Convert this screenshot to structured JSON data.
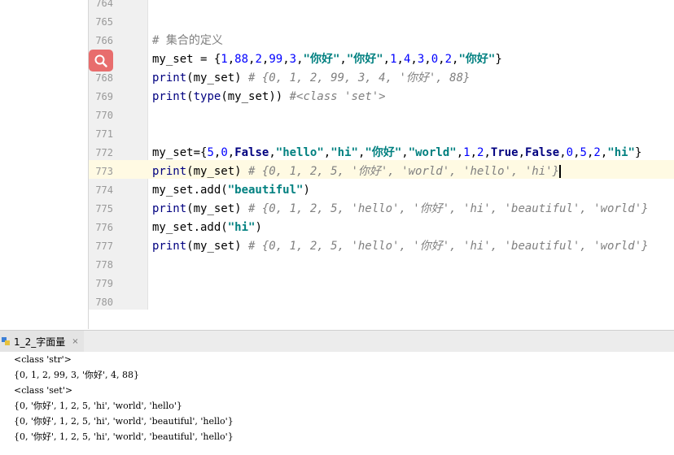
{
  "editor": {
    "lines": [
      {
        "no": "764"
      },
      {
        "no": "765"
      },
      {
        "no": "766",
        "parts": [
          {
            "t": "# 集合的定义",
            "c": "cm-plain"
          }
        ]
      },
      {
        "no": "",
        "parts": [
          {
            "t": "my_set = {",
            "c": ""
          },
          {
            "t": "1",
            "c": "num"
          },
          {
            "t": ",",
            "c": ""
          },
          {
            "t": "88",
            "c": "num"
          },
          {
            "t": ",",
            "c": ""
          },
          {
            "t": "2",
            "c": "num"
          },
          {
            "t": ",",
            "c": ""
          },
          {
            "t": "99",
            "c": "num"
          },
          {
            "t": ",",
            "c": ""
          },
          {
            "t": "3",
            "c": "num"
          },
          {
            "t": ",",
            "c": ""
          },
          {
            "t": "\"你好\"",
            "c": "str"
          },
          {
            "t": ",",
            "c": ""
          },
          {
            "t": "\"你好\"",
            "c": "str"
          },
          {
            "t": ",",
            "c": ""
          },
          {
            "t": "1",
            "c": "num"
          },
          {
            "t": ",",
            "c": ""
          },
          {
            "t": "4",
            "c": "num"
          },
          {
            "t": ",",
            "c": ""
          },
          {
            "t": "3",
            "c": "num"
          },
          {
            "t": ",",
            "c": ""
          },
          {
            "t": "0",
            "c": "num"
          },
          {
            "t": ",",
            "c": ""
          },
          {
            "t": "2",
            "c": "num"
          },
          {
            "t": ",",
            "c": ""
          },
          {
            "t": "\"你好\"",
            "c": "str"
          },
          {
            "t": "}",
            "c": ""
          }
        ]
      },
      {
        "no": "768",
        "parts": [
          {
            "t": "print",
            "c": "bi"
          },
          {
            "t": "(my_set) ",
            "c": ""
          },
          {
            "t": "# {0, 1, 2, 99, 3, 4, '你好', 88}",
            "c": "cm"
          }
        ]
      },
      {
        "no": "769",
        "parts": [
          {
            "t": "print",
            "c": "bi"
          },
          {
            "t": "(",
            "c": ""
          },
          {
            "t": "type",
            "c": "bi"
          },
          {
            "t": "(my_set)) ",
            "c": ""
          },
          {
            "t": "#<class 'set'>",
            "c": "cm"
          }
        ]
      },
      {
        "no": "770"
      },
      {
        "no": "771"
      },
      {
        "no": "772",
        "parts": [
          {
            "t": "my_set={",
            "c": ""
          },
          {
            "t": "5",
            "c": "num"
          },
          {
            "t": ",",
            "c": ""
          },
          {
            "t": "0",
            "c": "num"
          },
          {
            "t": ",",
            "c": ""
          },
          {
            "t": "False",
            "c": "kw"
          },
          {
            "t": ",",
            "c": ""
          },
          {
            "t": "\"hello\"",
            "c": "str"
          },
          {
            "t": ",",
            "c": ""
          },
          {
            "t": "\"hi\"",
            "c": "str"
          },
          {
            "t": ",",
            "c": ""
          },
          {
            "t": "\"你好\"",
            "c": "str"
          },
          {
            "t": ",",
            "c": ""
          },
          {
            "t": "\"world\"",
            "c": "str"
          },
          {
            "t": ",",
            "c": ""
          },
          {
            "t": "1",
            "c": "num"
          },
          {
            "t": ",",
            "c": ""
          },
          {
            "t": "2",
            "c": "num"
          },
          {
            "t": ",",
            "c": ""
          },
          {
            "t": "True",
            "c": "kw"
          },
          {
            "t": ",",
            "c": ""
          },
          {
            "t": "False",
            "c": "kw"
          },
          {
            "t": ",",
            "c": ""
          },
          {
            "t": "0",
            "c": "num"
          },
          {
            "t": ",",
            "c": ""
          },
          {
            "t": "5",
            "c": "num"
          },
          {
            "t": ",",
            "c": ""
          },
          {
            "t": "2",
            "c": "num"
          },
          {
            "t": ",",
            "c": ""
          },
          {
            "t": "\"hi\"",
            "c": "str"
          },
          {
            "t": "}",
            "c": ""
          }
        ]
      },
      {
        "no": "773",
        "parts": [
          {
            "t": "print",
            "c": "bi"
          },
          {
            "t": "(my_set) ",
            "c": ""
          },
          {
            "t": "# {0, 1, 2, 5, '你好', 'world', 'hello', 'hi'}",
            "c": "cm"
          }
        ],
        "cursor": true
      },
      {
        "no": "774",
        "parts": [
          {
            "t": "my_set.add(",
            "c": ""
          },
          {
            "t": "\"beautiful\"",
            "c": "str"
          },
          {
            "t": ")",
            "c": ""
          }
        ]
      },
      {
        "no": "775",
        "parts": [
          {
            "t": "print",
            "c": "bi"
          },
          {
            "t": "(my_set) ",
            "c": ""
          },
          {
            "t": "# {0, 1, 2, 5, 'hello', '你好', 'hi', 'beautiful', 'world'}",
            "c": "cm"
          }
        ]
      },
      {
        "no": "776",
        "parts": [
          {
            "t": "my_set.add(",
            "c": ""
          },
          {
            "t": "\"hi\"",
            "c": "str"
          },
          {
            "t": ")",
            "c": ""
          }
        ]
      },
      {
        "no": "777",
        "parts": [
          {
            "t": "print",
            "c": "bi"
          },
          {
            "t": "(my_set) ",
            "c": ""
          },
          {
            "t": "# {0, 1, 2, 5, 'hello', '你好', 'hi', 'beautiful', 'world'}",
            "c": "cm"
          }
        ]
      },
      {
        "no": "778"
      },
      {
        "no": "779"
      },
      {
        "no": "780"
      }
    ]
  },
  "run": {
    "tab_label": "1_2_字面量",
    "close_glyph": "×",
    "output": [
      "<class 'str'>",
      "{0, 1, 2, 99, 3, '你好', 4, 88}",
      "<class 'set'>",
      "{0, '你好', 1, 2, 5, 'hi', 'world', 'hello'}",
      "{0, '你好', 1, 2, 5, 'hi', 'world', 'beautiful', 'hello'}",
      "{0, '你好', 1, 2, 5, 'hi', 'world', 'beautiful', 'hello'}"
    ]
  },
  "colors": {
    "keyword": "#000080",
    "string": "#008080",
    "number": "#0000ff",
    "comment": "#808080",
    "caret_row": "#fffae3",
    "search_button": "#e86d6d"
  },
  "icons": {
    "gutter_action": "search-icon",
    "run_tab": "python-file-icon"
  }
}
